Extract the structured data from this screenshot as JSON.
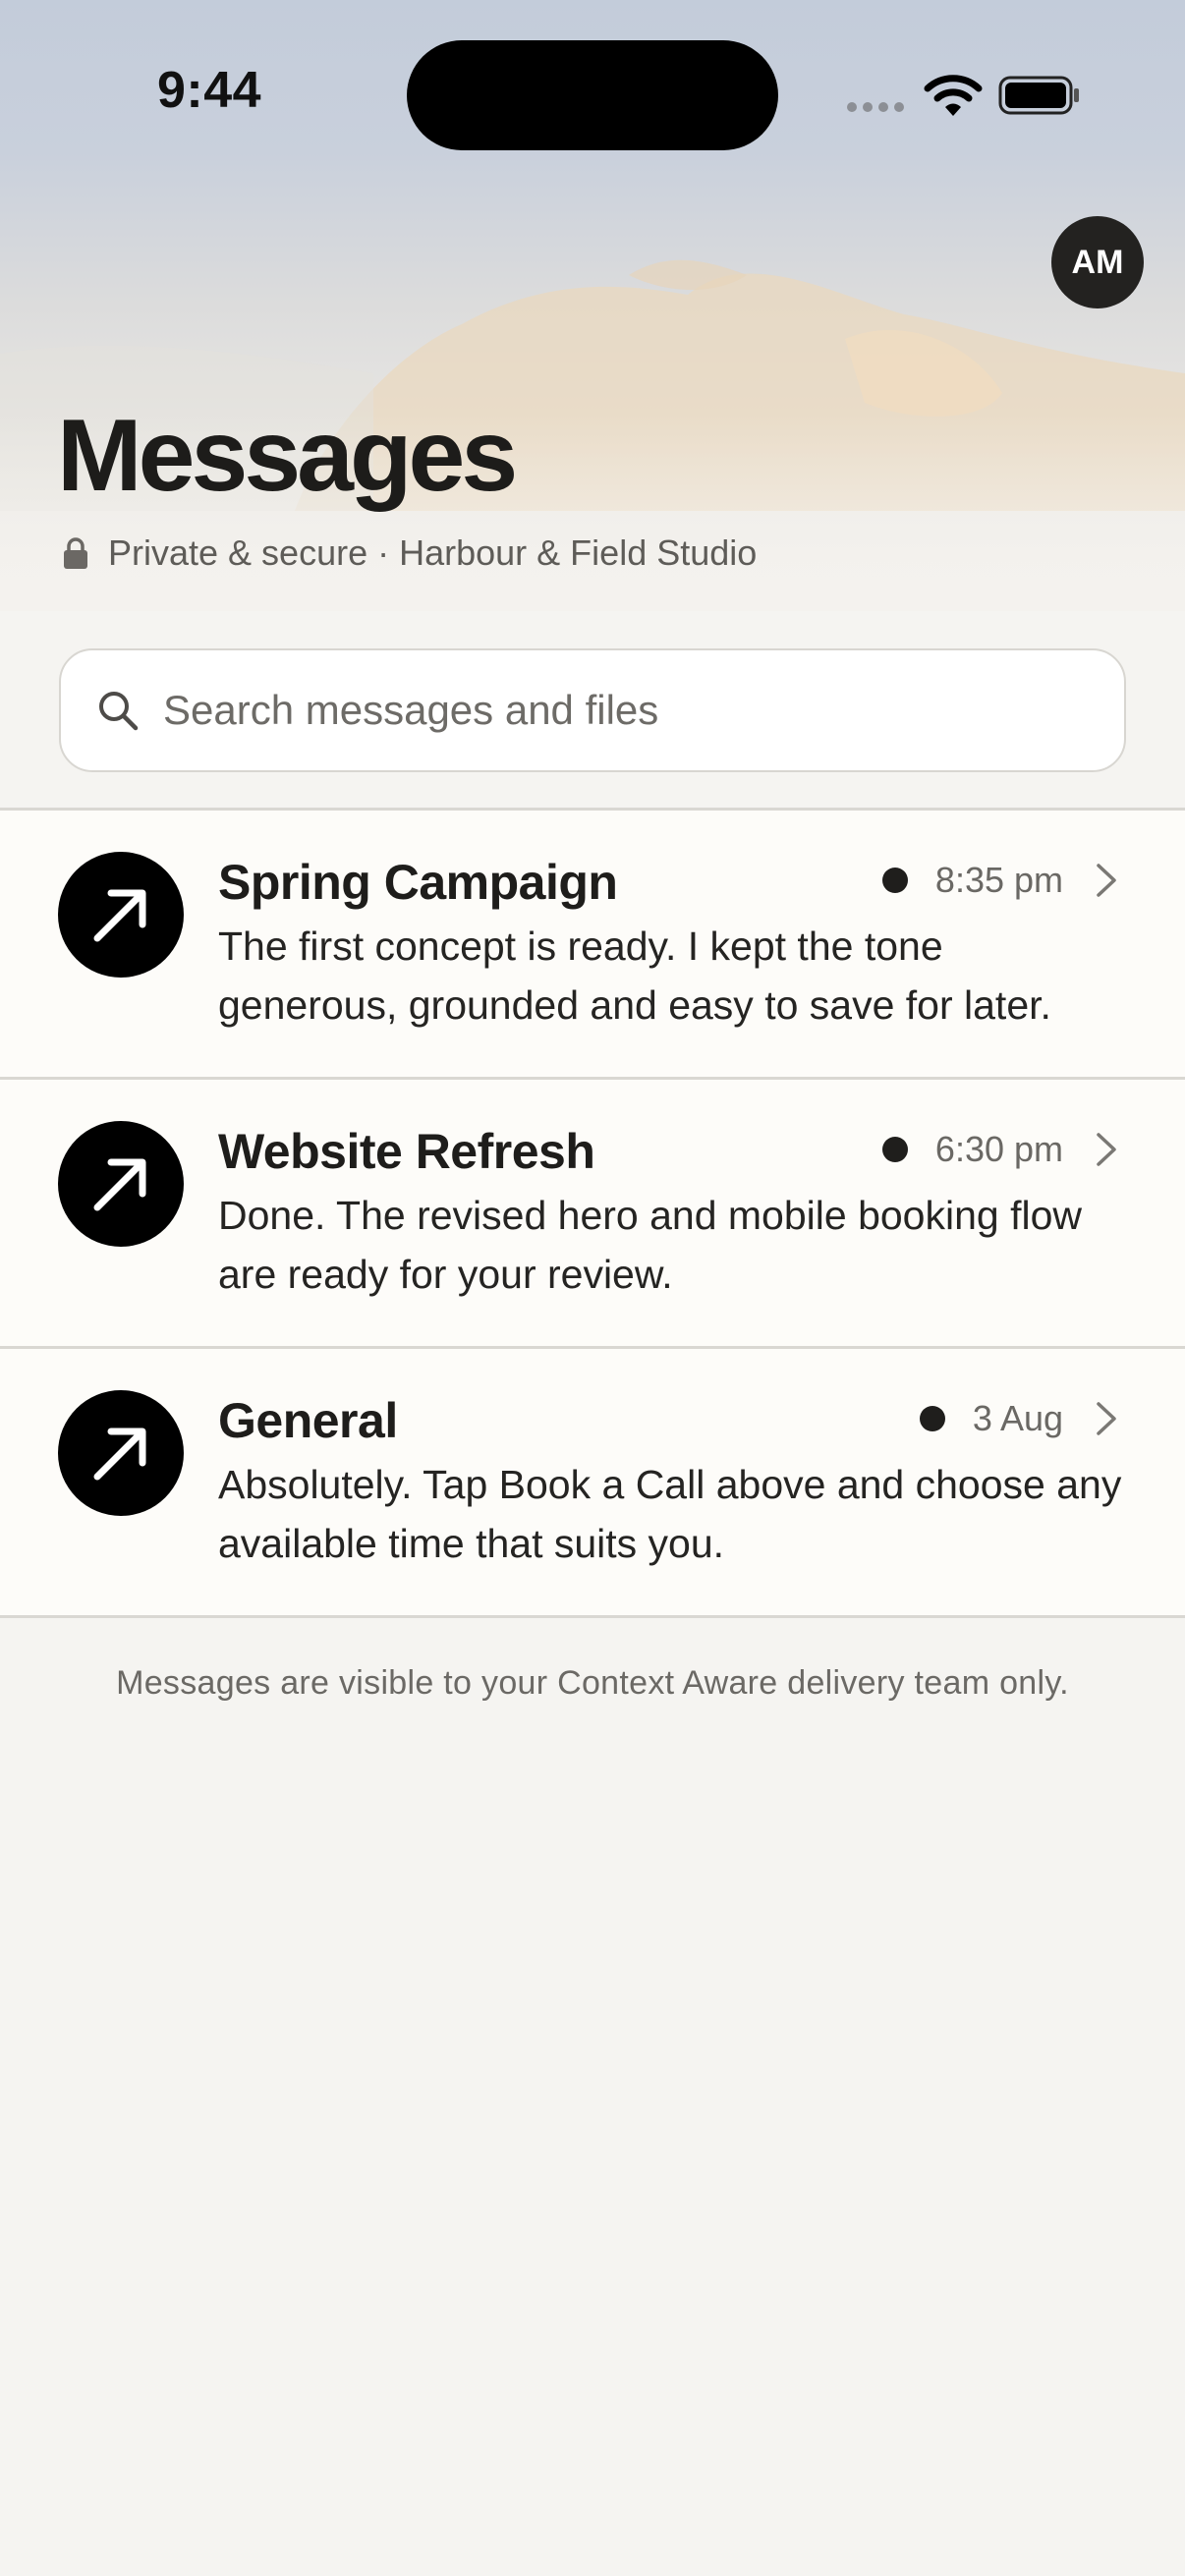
{
  "status_bar": {
    "time": "9:44"
  },
  "header": {
    "avatar_initials": "AM",
    "title": "Messages",
    "subtitle": "Private & secure · Harbour & Field Studio"
  },
  "search": {
    "placeholder": "Search messages and files"
  },
  "conversations": [
    {
      "title": "Spring Campaign",
      "time": "8:35 pm",
      "unread": true,
      "preview": "The first concept is ready. I kept the tone generous, grounded and easy to save for later."
    },
    {
      "title": "Website Refresh",
      "time": "6:30 pm",
      "unread": true,
      "preview": "Done. The revised hero and mobile booking flow are ready for your review."
    },
    {
      "title": "General",
      "time": "3 Aug",
      "unread": true,
      "preview": "Absolutely. Tap Book a Call above and choose any available time that suits you."
    }
  ],
  "footer": {
    "note": "Messages are visible to your Context Aware delivery team only."
  },
  "icons": {
    "row_avatar": "arrow-up-right-icon",
    "lock": "lock-icon",
    "search": "search-icon",
    "chevron": "chevron-right-icon"
  },
  "colors": {
    "background": "#f5f4f1",
    "row_background": "#fdfcf9",
    "ink": "#1f1e1c",
    "muted": "#6a6864",
    "divider": "#d9d7d2"
  }
}
